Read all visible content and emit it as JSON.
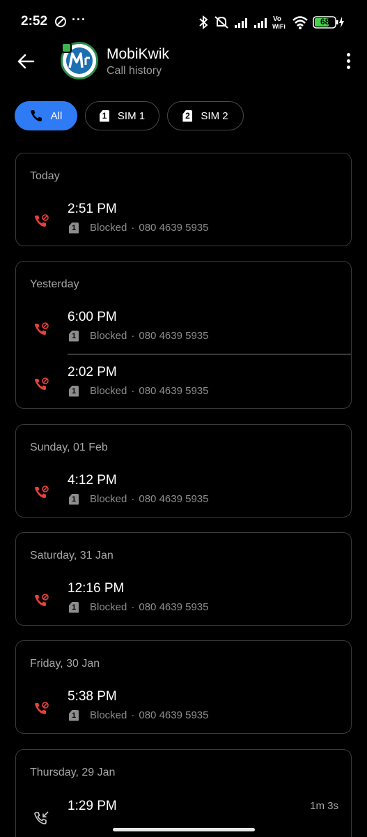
{
  "status_bar": {
    "time": "2:52",
    "dots": "···",
    "battery": "68"
  },
  "header": {
    "title": "MobiKwik",
    "subtitle": "Call history"
  },
  "filters": [
    {
      "label": "All",
      "sim": ""
    },
    {
      "label": "SIM 1",
      "sim": "1"
    },
    {
      "label": "SIM 2",
      "sim": "2"
    }
  ],
  "groups": [
    {
      "date": "Today",
      "entries": [
        {
          "time": "2:51 PM",
          "sim": "1",
          "status": "Blocked",
          "number": "080 4639 5935",
          "type": "blocked"
        }
      ]
    },
    {
      "date": "Yesterday",
      "entries": [
        {
          "time": "6:00 PM",
          "sim": "1",
          "status": "Blocked",
          "number": "080 4639 5935",
          "type": "blocked"
        },
        {
          "time": "2:02 PM",
          "sim": "1",
          "status": "Blocked",
          "number": "080 4639 5935",
          "type": "blocked"
        }
      ]
    },
    {
      "date": "Sunday, 01 Feb",
      "entries": [
        {
          "time": "4:12 PM",
          "sim": "1",
          "status": "Blocked",
          "number": "080 4639 5935",
          "type": "blocked"
        }
      ]
    },
    {
      "date": "Saturday, 31 Jan",
      "entries": [
        {
          "time": "12:16 PM",
          "sim": "1",
          "status": "Blocked",
          "number": "080 4639 5935",
          "type": "blocked"
        }
      ]
    },
    {
      "date": "Friday, 30 Jan",
      "entries": [
        {
          "time": "5:38 PM",
          "sim": "1",
          "status": "Blocked",
          "number": "080 4639 5935",
          "type": "blocked"
        }
      ]
    },
    {
      "date": "Thursday, 29 Jan",
      "entries": [
        {
          "time": "1:29 PM",
          "duration": "1m 3s",
          "type": "incoming"
        }
      ]
    }
  ],
  "colors": {
    "accent": "#2f7bf5",
    "blocked_icon": "#e8413c",
    "card_border": "#3a3a3a",
    "secondary_text": "#8d8d8d"
  }
}
